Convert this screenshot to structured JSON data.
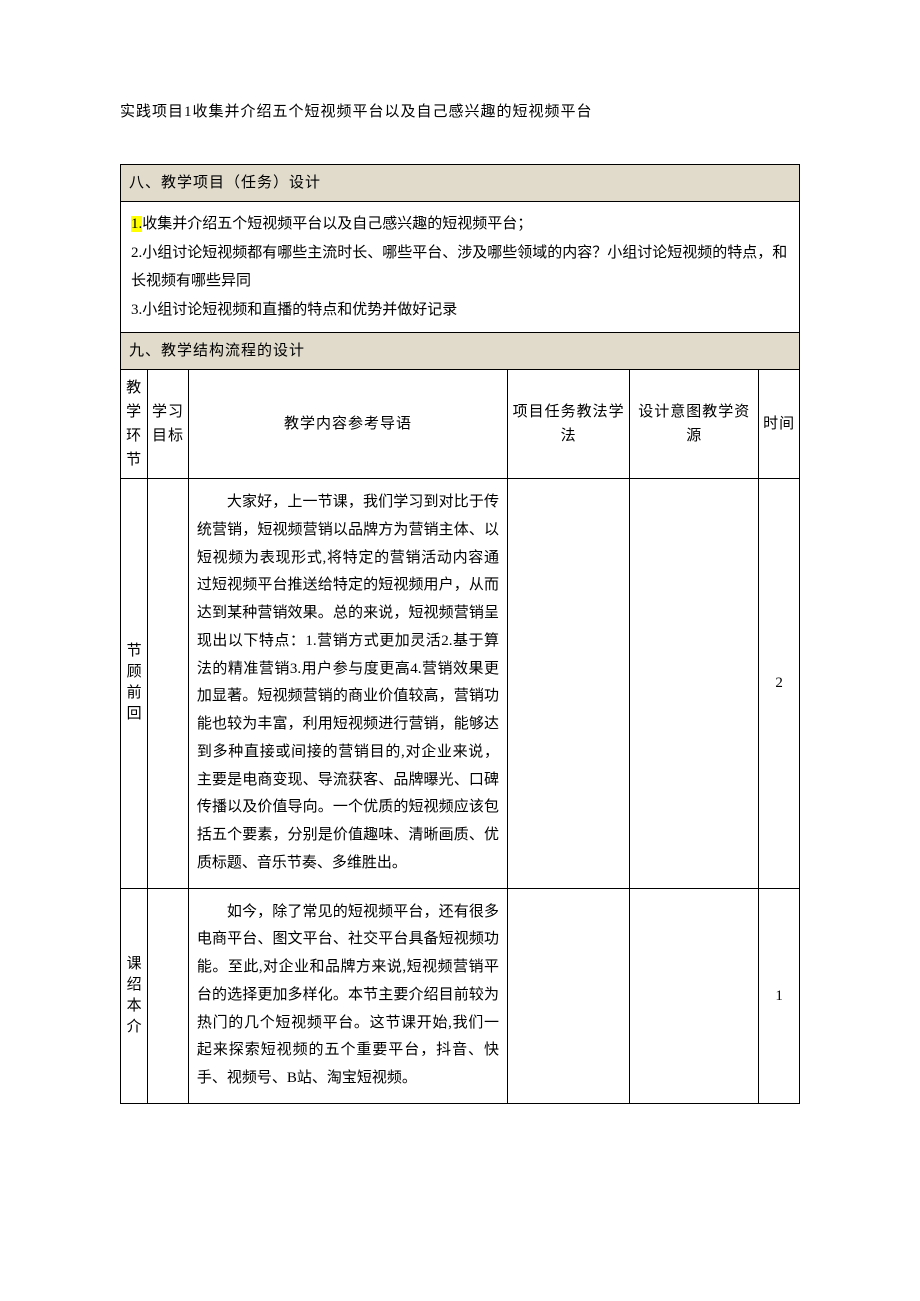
{
  "page_intro": "实践项目1收集并介绍五个短视频平台以及自己感兴趣的短视频平台",
  "section8": {
    "title": "八、教学项目（任务）设计",
    "tasks": {
      "num1": "1.",
      "text1": "收集并介绍五个短视频平台以及自己感兴趣的短视频平台；",
      "line2": "2.小组讨论短视频都有哪些主流时长、哪些平台、涉及哪些领域的内容？小组讨论短视频的特点，和长视频有哪些异同",
      "line3": "3.小组讨论短视频和直播的特点和优势并做好记录"
    }
  },
  "section9": {
    "title": "九、教学结构流程的设计",
    "headers": {
      "phase": "教学环节",
      "goal": "学习目标",
      "content": "教学内容参考导语",
      "method": "项目任务教法学法",
      "purpose": "设计意图教学资源",
      "time": "时间"
    },
    "rows": [
      {
        "phase": "节顾前回",
        "goal": "",
        "content": "大家好，上一节课，我们学习到对比于传统营销，短视频营销以品牌方为营销主体、以短视频为表现形式,将特定的营销活动内容通过短视频平台推送给特定的短视频用户，从而达到某种营销效果。总的来说，短视频营销呈现出以下特点：1.营销方式更加灵活2.基于算法的精准营销3.用户参与度更高4.营销效果更加显著。短视频营销的商业价值较高，营销功能也较为丰富，利用短视频进行营销，能够达到多种直接或间接的营销目的,对企业来说，主要是电商变现、导流获客、品牌曝光、口碑传播以及价值导向。一个优质的短视频应该包括五个要素，分别是价值趣味、清晰画质、优质标题、音乐节奏、多维胜出。",
        "method": "",
        "purpose": "",
        "time": "2"
      },
      {
        "phase": "课绍本介",
        "goal": "",
        "content": "如今，除了常见的短视频平台，还有很多电商平台、图文平台、社交平台具备短视频功能。至此,对企业和品牌方来说,短视频营销平台的选择更加多样化。本节主要介绍目前较为热门的几个短视频平台。这节课开始,我们一起来探索短视频的五个重要平台，抖音、快手、视频号、B站、淘宝短视频。",
        "method": "",
        "purpose": "",
        "time": "1"
      }
    ]
  }
}
